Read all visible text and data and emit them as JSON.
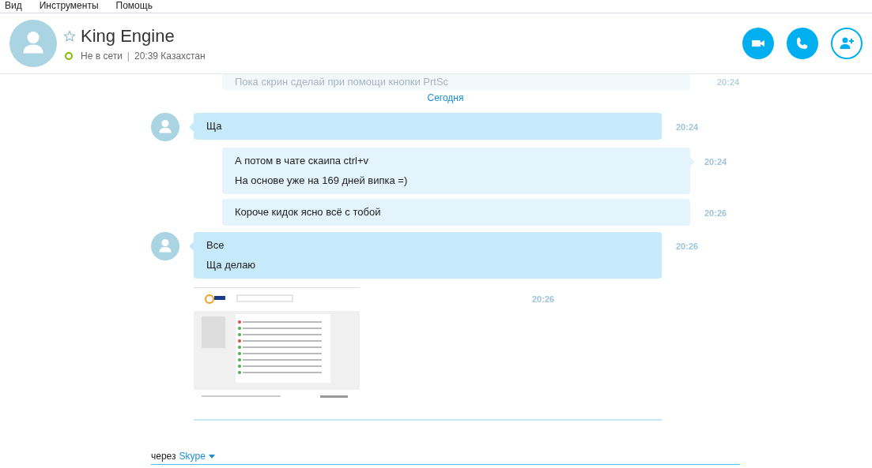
{
  "menu": [
    "Вид",
    "Инструменты",
    "Помощь"
  ],
  "contact": {
    "name": "King Engine",
    "favorite": false,
    "online": false,
    "status_text": "Не в сети",
    "separator": "|",
    "local_time": "20:39 Казахстан"
  },
  "header_buttons": [
    {
      "kind": "video"
    },
    {
      "kind": "call"
    },
    {
      "kind": "add-contact"
    }
  ],
  "faded_message": {
    "text": "Пока скрин сделай при помощи кнопки PrtSc",
    "time": "20:24"
  },
  "date_divider": "Сегодня",
  "messages": [
    {
      "from_me": false,
      "kind": "text",
      "lines": [
        "Ща"
      ],
      "time": "20:24"
    },
    {
      "from_me": true,
      "kind": "text",
      "lines": [
        "А потом в чате скаипа ctrl+v",
        "На основе уже на 169 дней випка =)"
      ],
      "time": "20:24"
    },
    {
      "from_me": true,
      "kind": "text",
      "lines": [
        "Короче кидок ясно всё с тобой"
      ],
      "time": "20:26"
    },
    {
      "from_me": false,
      "kind": "text",
      "lines": [
        "Все",
        "Ща делаю"
      ],
      "time": "20:26"
    },
    {
      "from_me": false,
      "kind": "image",
      "time": "20:26"
    }
  ],
  "footer": {
    "prefix": "через",
    "service": "Skype"
  }
}
